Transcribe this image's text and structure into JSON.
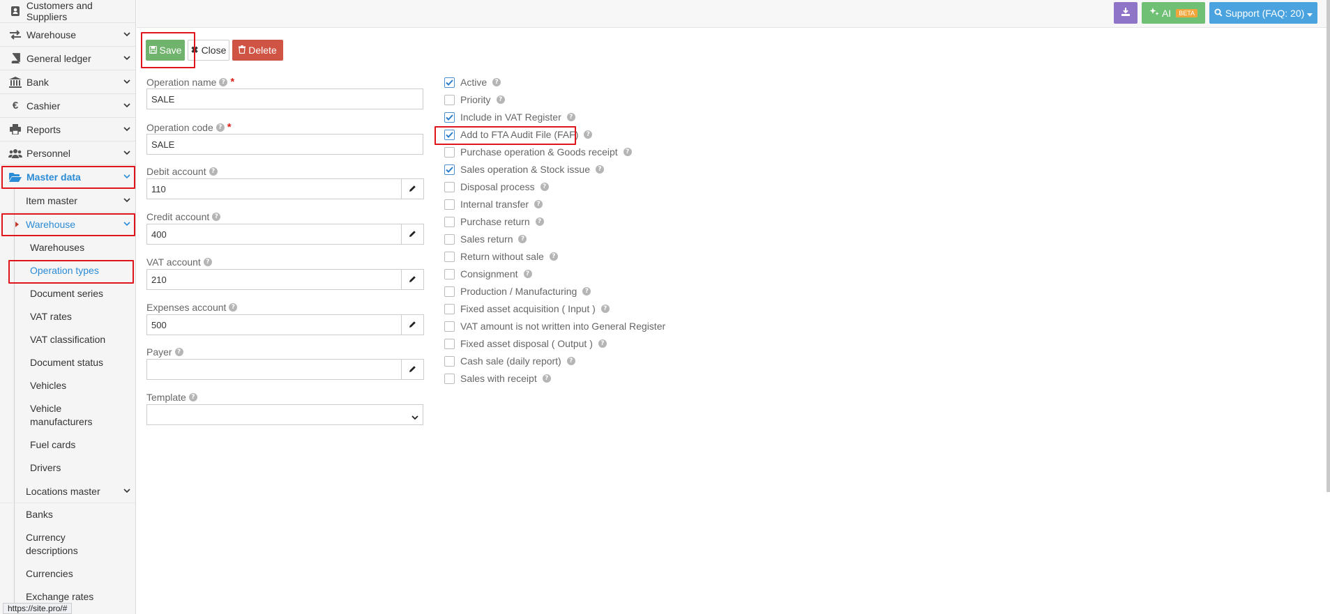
{
  "sidebar": {
    "items": [
      {
        "label": "Customers and Suppliers",
        "icon": "address-book-icon"
      },
      {
        "label": "Warehouse",
        "icon": "exchange-icon"
      },
      {
        "label": "General ledger",
        "icon": "book-icon"
      },
      {
        "label": "Bank",
        "icon": "bank-icon"
      },
      {
        "label": "Cashier",
        "icon": "euro-icon"
      },
      {
        "label": "Reports",
        "icon": "print-icon"
      },
      {
        "label": "Personnel",
        "icon": "users-icon"
      },
      {
        "label": "Master data",
        "icon": "folder-open-icon"
      }
    ],
    "master_sub": {
      "item_master": "Item master",
      "warehouse": "Warehouse",
      "warehouse_children": [
        "Warehouses",
        "Operation types",
        "Document series",
        "VAT rates",
        "VAT classification",
        "Document status",
        "Vehicles",
        "Vehicle manufacturers",
        "Fuel cards",
        "Drivers"
      ],
      "locations_master": "Locations master",
      "others": [
        "Banks",
        "Currency descriptions",
        "Currencies",
        "Exchange rates"
      ]
    }
  },
  "topbar": {
    "ai_label": "AI",
    "beta_label": "BETA",
    "support_label": "Support (FAQ: 20)"
  },
  "actions": {
    "save": "Save",
    "close": "Close",
    "delete": "Delete"
  },
  "form": {
    "operation_name_label": "Operation name",
    "operation_name_value": "SALE",
    "operation_code_label": "Operation code",
    "operation_code_value": "SALE",
    "debit_account_label": "Debit account",
    "debit_account_value": "110",
    "credit_account_label": "Credit account",
    "credit_account_value": "400",
    "vat_account_label": "VAT account",
    "vat_account_value": "210",
    "expenses_account_label": "Expenses account",
    "expenses_account_value": "500",
    "payer_label": "Payer",
    "payer_value": "",
    "template_label": "Template",
    "template_value": ""
  },
  "checkboxes": [
    {
      "label": "Active",
      "checked": true
    },
    {
      "label": "Priority",
      "checked": false
    },
    {
      "label": "Include in VAT Register",
      "checked": true
    },
    {
      "label": "Add to FTA Audit File (FAF)",
      "checked": true
    },
    {
      "label": "Purchase operation & Goods receipt",
      "checked": false
    },
    {
      "label": "Sales operation & Stock issue",
      "checked": true
    },
    {
      "label": "Disposal process",
      "checked": false
    },
    {
      "label": "Internal transfer",
      "checked": false
    },
    {
      "label": "Purchase return",
      "checked": false
    },
    {
      "label": "Sales return",
      "checked": false
    },
    {
      "label": "Return without sale",
      "checked": false
    },
    {
      "label": "Consignment",
      "checked": false
    },
    {
      "label": "Production / Manufacturing",
      "checked": false
    },
    {
      "label": "Fixed asset acquisition ( Input )",
      "checked": false
    },
    {
      "label": "VAT amount is not written into General Register",
      "checked": false
    },
    {
      "label": "Fixed asset disposal ( Output )",
      "checked": false
    },
    {
      "label": "Cash sale (daily report)",
      "checked": false
    },
    {
      "label": "Sales with receipt",
      "checked": false
    }
  ],
  "status_url": "https://site.pro/#",
  "colors": {
    "accent": "#2a8bd6",
    "highlight": "#e0151c",
    "save": "#6fb36c",
    "delete": "#d05444"
  }
}
